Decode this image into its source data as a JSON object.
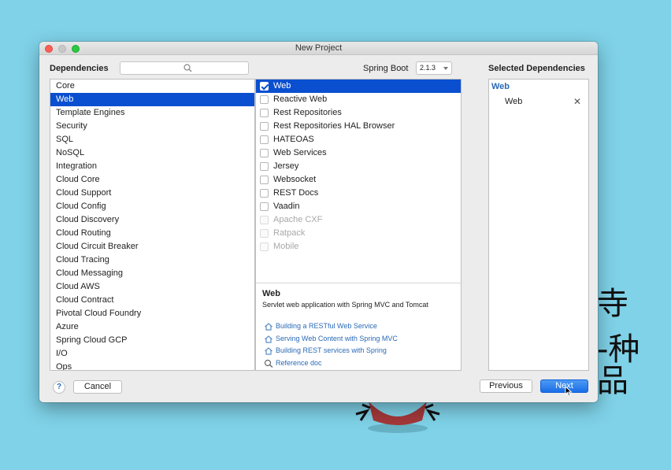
{
  "window": {
    "title": "New Project"
  },
  "header": {
    "dependencies_label": "Dependencies",
    "search_placeholder": "",
    "spring_boot_label": "Spring Boot",
    "spring_boot_version": "2.1.3",
    "selected_title": "Selected Dependencies"
  },
  "categories": [
    {
      "label": "Core",
      "selected": false
    },
    {
      "label": "Web",
      "selected": true
    },
    {
      "label": "Template Engines",
      "selected": false
    },
    {
      "label": "Security",
      "selected": false
    },
    {
      "label": "SQL",
      "selected": false
    },
    {
      "label": "NoSQL",
      "selected": false
    },
    {
      "label": "Integration",
      "selected": false
    },
    {
      "label": "Cloud Core",
      "selected": false
    },
    {
      "label": "Cloud Support",
      "selected": false
    },
    {
      "label": "Cloud Config",
      "selected": false
    },
    {
      "label": "Cloud Discovery",
      "selected": false
    },
    {
      "label": "Cloud Routing",
      "selected": false
    },
    {
      "label": "Cloud Circuit Breaker",
      "selected": false
    },
    {
      "label": "Cloud Tracing",
      "selected": false
    },
    {
      "label": "Cloud Messaging",
      "selected": false
    },
    {
      "label": "Cloud AWS",
      "selected": false
    },
    {
      "label": "Cloud Contract",
      "selected": false
    },
    {
      "label": "Pivotal Cloud Foundry",
      "selected": false
    },
    {
      "label": "Azure",
      "selected": false
    },
    {
      "label": "Spring Cloud GCP",
      "selected": false
    },
    {
      "label": "I/O",
      "selected": false
    },
    {
      "label": "Ops",
      "selected": false
    }
  ],
  "dependencies": [
    {
      "label": "Web",
      "checked": true,
      "selected": true,
      "disabled": false
    },
    {
      "label": "Reactive Web",
      "checked": false,
      "selected": false,
      "disabled": false
    },
    {
      "label": "Rest Repositories",
      "checked": false,
      "selected": false,
      "disabled": false
    },
    {
      "label": "Rest Repositories HAL Browser",
      "checked": false,
      "selected": false,
      "disabled": false
    },
    {
      "label": "HATEOAS",
      "checked": false,
      "selected": false,
      "disabled": false
    },
    {
      "label": "Web Services",
      "checked": false,
      "selected": false,
      "disabled": false
    },
    {
      "label": "Jersey",
      "checked": false,
      "selected": false,
      "disabled": false
    },
    {
      "label": "Websocket",
      "checked": false,
      "selected": false,
      "disabled": false
    },
    {
      "label": "REST Docs",
      "checked": false,
      "selected": false,
      "disabled": false
    },
    {
      "label": "Vaadin",
      "checked": false,
      "selected": false,
      "disabled": false
    },
    {
      "label": "Apache CXF",
      "checked": false,
      "selected": false,
      "disabled": true
    },
    {
      "label": "Ratpack",
      "checked": false,
      "selected": false,
      "disabled": true
    },
    {
      "label": "Mobile",
      "checked": false,
      "selected": false,
      "disabled": true
    }
  ],
  "description": {
    "title": "Web",
    "text": "Servlet web application with Spring MVC and Tomcat",
    "links": [
      {
        "label": "Building a RESTful Web Service",
        "icon": "guide-icon"
      },
      {
        "label": "Serving Web Content with Spring MVC",
        "icon": "guide-icon"
      },
      {
        "label": "Building REST services with Spring",
        "icon": "guide-icon"
      },
      {
        "label": "Reference doc",
        "icon": "reference-icon"
      }
    ]
  },
  "selected": {
    "group": "Web",
    "items": [
      {
        "label": "Web",
        "remove": "✕"
      }
    ]
  },
  "footer": {
    "help": "?",
    "cancel": "Cancel",
    "previous": "Previous",
    "next": "Next"
  },
  "background": {
    "line1": "寺",
    "line2": "-种 品"
  },
  "colors": {
    "accent": "#0a4fd0",
    "link": "#2a6ab6",
    "background": "#7fd2e8"
  }
}
